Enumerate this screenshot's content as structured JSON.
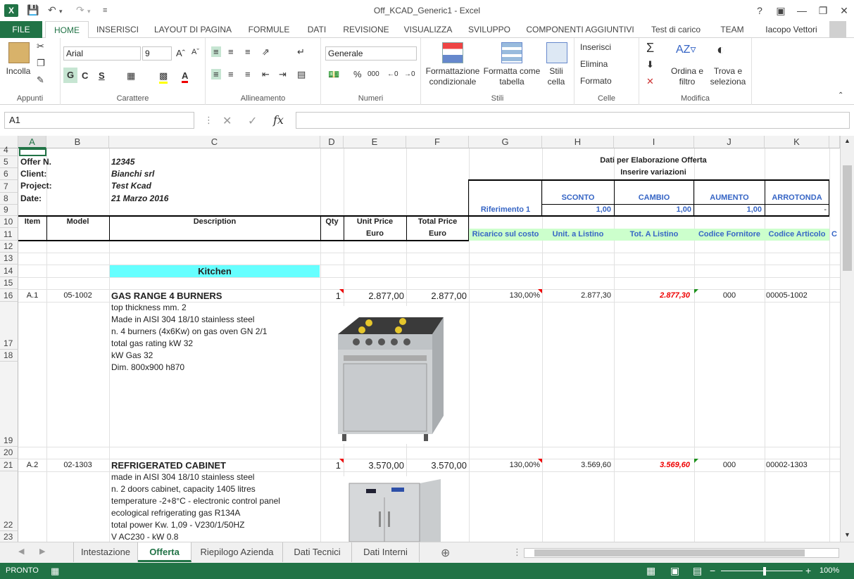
{
  "window": {
    "title": "Off_KCAD_Generic1 - Excel",
    "user": "Iacopo Vettori"
  },
  "ribbon_tabs": [
    "FILE",
    "HOME",
    "INSERISCI",
    "LAYOUT DI PAGINA",
    "FORMULE",
    "DATI",
    "REVISIONE",
    "VISUALIZZA",
    "SVILUPPO",
    "COMPONENTI AGGIUNTIVI",
    "Test di carico",
    "TEAM"
  ],
  "ribbon": {
    "paste": "Incolla",
    "group_clipboard": "Appunti",
    "font_name": "Arial",
    "font_size": "9",
    "bold": "G",
    "italic": "C",
    "underline": "S",
    "group_font": "Carattere",
    "group_align": "Allineamento",
    "number_format": "Generale",
    "group_number": "Numeri",
    "cond_format": "Formattazione condizionale",
    "format_table": "Formatta come tabella",
    "cell_styles": "Stili cella",
    "group_styles": "Stili",
    "insert": "Inserisci",
    "delete": "Elimina",
    "format": "Formato",
    "group_cells": "Celle",
    "sort": "Ordina e filtro",
    "find": "Trova e seleziona",
    "group_edit": "Modifica"
  },
  "formula_bar": {
    "name_box": "A1",
    "fx": "fx",
    "value": ""
  },
  "columns": [
    "A",
    "B",
    "C",
    "D",
    "E",
    "F",
    "G",
    "H",
    "I",
    "J",
    "K"
  ],
  "rows": [
    "4",
    "5",
    "6",
    "7",
    "8",
    "9",
    "10",
    "11",
    "12",
    "13",
    "14",
    "15",
    "16",
    "17",
    "18",
    "19",
    "20",
    "21",
    "22",
    "23"
  ],
  "header": {
    "offer_label": "Offer N.",
    "offer_value": "12345",
    "client_label": "Client:",
    "client_value": "Bianchi srl",
    "project_label": "Project:",
    "project_value": "Test Kcad",
    "date_label": "Date:",
    "date_value": "21 Marzo 2016",
    "dati_title": "Dati per Elaborazione Offerta",
    "inserire": "Inserire variazioni",
    "sconto": "SCONTO",
    "cambio": "CAMBIO",
    "aumento": "AUMENTO",
    "arrotonda": "ARROTONDA",
    "riferimento": "Riferimento 1",
    "sconto_val": "1,00",
    "cambio_val": "1,00",
    "aumento_val": "1,00",
    "arrotonda_val": "-"
  },
  "table_header": {
    "item": "Item",
    "model": "Model",
    "description": "Description",
    "qty": "Qty",
    "unit_price": "Unit Price",
    "total_price": "Total Price",
    "euro1": "Euro",
    "euro2": "Euro",
    "ricarico": "Ricarico sul costo",
    "unit_listino": "Unit. a Listino",
    "tot_listino": "Tot. A Listino",
    "cod_fornitore": "Codice Fornitore",
    "cod_articolo": "Codice Articolo",
    "next_col": "C"
  },
  "section": "Kitchen",
  "items": [
    {
      "item": "A.1",
      "model": "05-1002",
      "title": "GAS RANGE 4 BURNERS",
      "qty": "1",
      "unit": "2.877,00",
      "total": "2.877,00",
      "ricarico": "130,00%",
      "unit_listino": "2.877,30",
      "tot_listino": "2.877,30",
      "fornitore": "000",
      "articolo": "00005-1002",
      "desc": [
        "top thickness mm. 2",
        "Made in AISI 304 18/10 stainless steel",
        "n. 4 burners (4x6Kw) on gas oven GN 2/1",
        "total gas rating kW 32",
        "kW Gas 32",
        "Dim. 800x900 h870"
      ]
    },
    {
      "item": "A.2",
      "model": "02-1303",
      "title": "REFRIGERATED CABINET",
      "qty": "1",
      "unit": "3.570,00",
      "total": "3.570,00",
      "ricarico": "130,00%",
      "unit_listino": "3.569,60",
      "tot_listino": "3.569,60",
      "fornitore": "000",
      "articolo": "00002-1303",
      "desc": [
        "made in AISI 304 18/10 stainless steel",
        "n. 2 doors cabinet, capacity 1405 litres",
        "temperature  -2+8°C - electronic control panel",
        "ecological refrigerating gas R134A",
        "total power Kw. 1,09 - V230/1/50HZ",
        "V AC230 - kW 0.8"
      ]
    }
  ],
  "sheets": [
    "Intestazione",
    "Offerta",
    "Riepilogo Azienda",
    "Dati Tecnici",
    "Dati Interni"
  ],
  "status": {
    "ready": "PRONTO",
    "zoom": "100%"
  },
  "colors": {
    "excel_green": "#217346",
    "cyan_fill": "#66ffff",
    "light_green": "#ccffcc",
    "blue_text": "#3665c5"
  }
}
